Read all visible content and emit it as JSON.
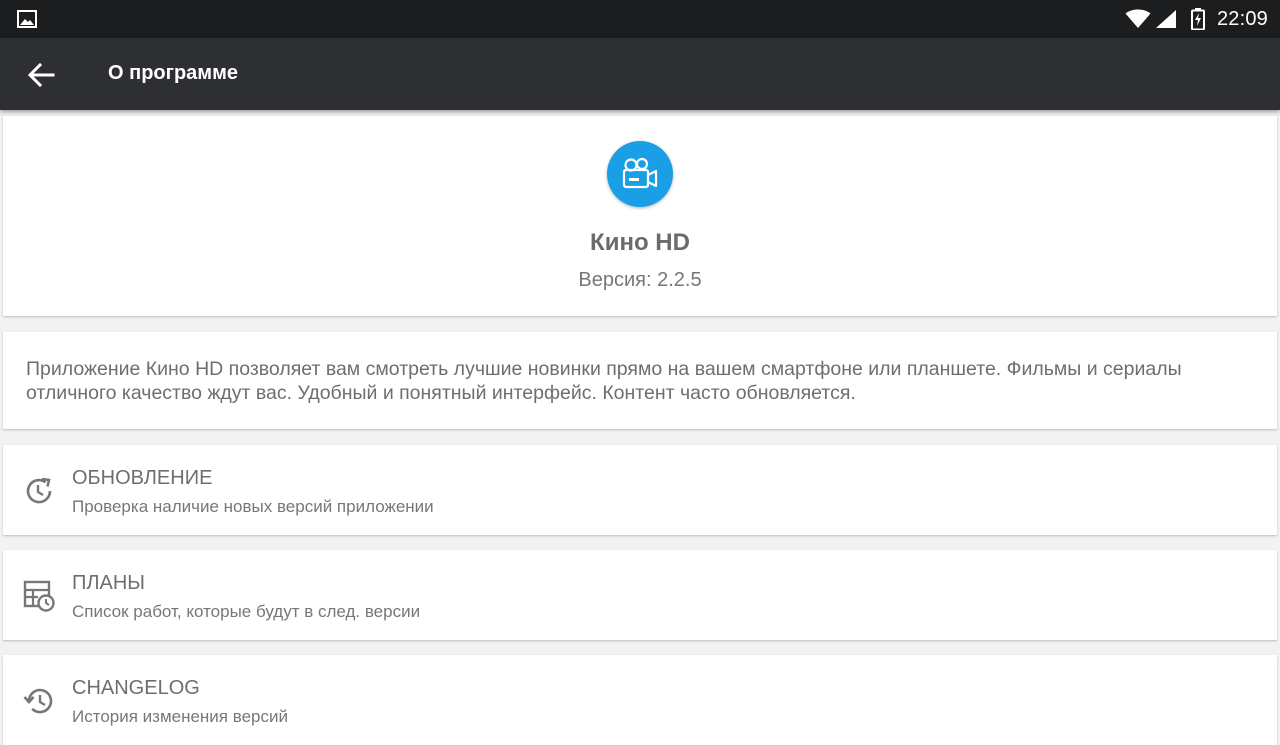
{
  "status_bar": {
    "time": "22:09",
    "icons": [
      "image-icon",
      "wifi-icon",
      "cell-signal-icon",
      "battery-charging-icon"
    ]
  },
  "app_bar": {
    "title": "О программе",
    "back_icon": "arrow-back-icon"
  },
  "header": {
    "app_name": "Кино HD",
    "version": "Версия: 2.2.5",
    "logo_icon": "video-camera-icon",
    "logo_color": "#1a9ee6"
  },
  "description": {
    "text": "Приложение Кино HD позволяет вам смотреть лучшие новинки прямо на вашем смартфоне или планшете. Фильмы и сериалы отличного качество ждут вас. Удобный и понятный интерфейс. Контент часто обновляется."
  },
  "items": [
    {
      "icon": "update-icon",
      "title": "ОБНОВЛЕНИЕ",
      "subtitle": "Проверка наличие новых версий приложении"
    },
    {
      "icon": "schedule-list-icon",
      "title": "ПЛАНЫ",
      "subtitle": "Список работ, которые будут в след. версии"
    },
    {
      "icon": "history-icon",
      "title": "CHANGELOG",
      "subtitle": "История изменения версий"
    }
  ]
}
